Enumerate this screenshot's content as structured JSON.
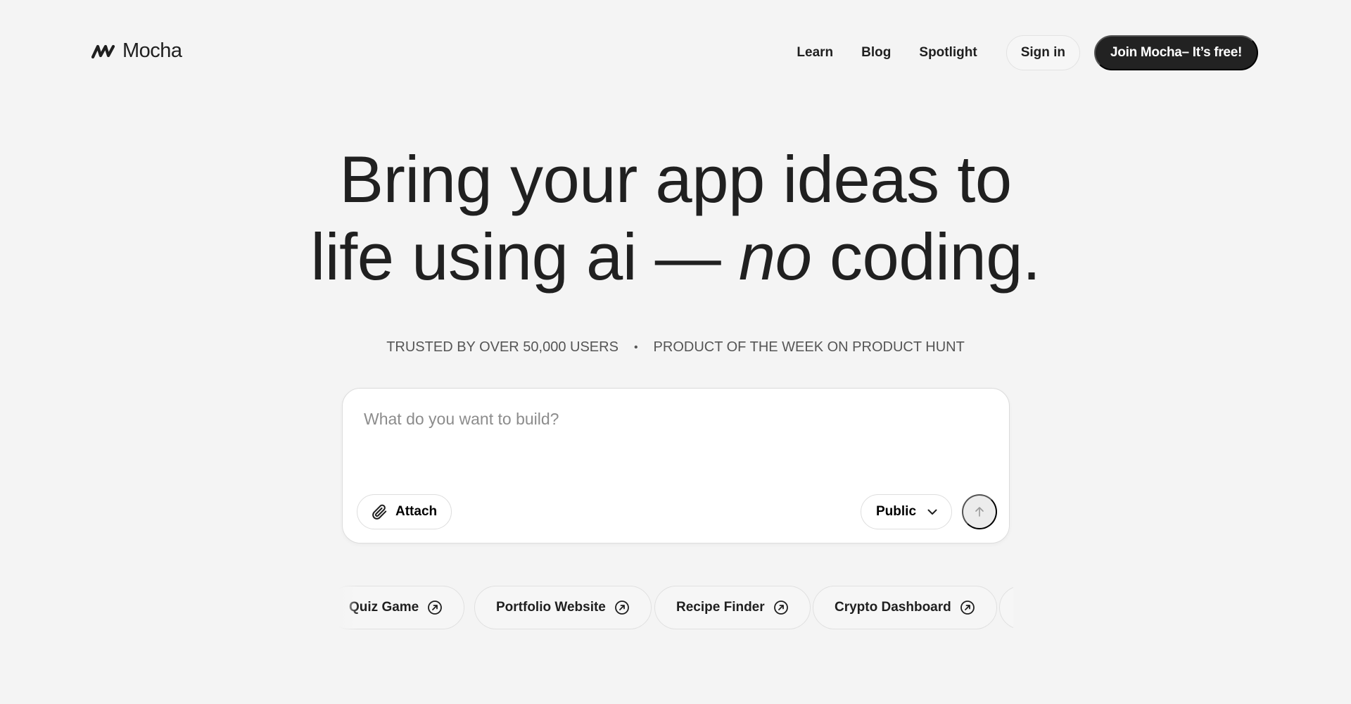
{
  "header": {
    "logo_text": "Mocha",
    "nav": [
      "Learn",
      "Blog",
      "Spotlight"
    ],
    "signin_label": "Sign in",
    "join_label": "Join Mocha– It’s free!"
  },
  "hero": {
    "line1": "Bring your app ideas to",
    "line2_start": "life using ai — ",
    "line2_emph": "no",
    "line2_end": " coding."
  },
  "trust": {
    "left": "TRUSTED BY OVER 50,000 USERS",
    "separator": "•",
    "right": "PRODUCT OF THE WEEK ON PRODUCT HUNT"
  },
  "prompt": {
    "placeholder": "What do you want to build?",
    "value": "",
    "attach_label": "Attach",
    "visibility_label": "Public"
  },
  "suggestions": [
    "Quiz Game",
    "Portfolio Website",
    "Recipe Finder",
    "Crypto Dashboard"
  ],
  "icons": {
    "logo": "mocha-logo-mark",
    "attach": "paperclip-icon",
    "visibility": "chevron-down-icon",
    "send": "arrow-up-icon",
    "chip": "arrow-up-right-circle-icon"
  },
  "colors": {
    "background": "#f4f4f4",
    "primary_button": "#222222",
    "text": "#1f1f1f",
    "muted_text": "#555555",
    "placeholder": "#8c8c8c"
  }
}
